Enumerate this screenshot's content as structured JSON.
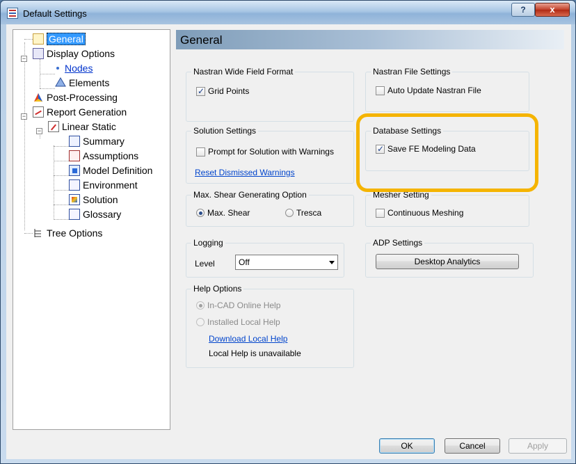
{
  "window": {
    "title": "Default Settings",
    "help_label": "?",
    "close_label": "x"
  },
  "tree": {
    "items": [
      {
        "label": "General",
        "icon": "general-settings-icon"
      },
      {
        "label": "Display Options",
        "icon": "display-options-icon"
      },
      {
        "label": "Nodes",
        "icon": "bullet-icon"
      },
      {
        "label": "Elements",
        "icon": "elements-icon"
      },
      {
        "label": "Post-Processing",
        "icon": "post-processing-icon"
      },
      {
        "label": "Report Generation",
        "icon": "report-generation-icon"
      },
      {
        "label": "Linear Static",
        "icon": "linear-static-icon"
      },
      {
        "label": "Summary",
        "icon": "summary-icon"
      },
      {
        "label": "Assumptions",
        "icon": "assumptions-icon"
      },
      {
        "label": "Model Definition",
        "icon": "model-definition-icon"
      },
      {
        "label": "Environment",
        "icon": "environment-icon"
      },
      {
        "label": "Solution",
        "icon": "solution-icon"
      },
      {
        "label": "Glossary",
        "icon": "glossary-icon"
      },
      {
        "label": "Tree Options",
        "icon": "tree-options-icon"
      }
    ],
    "expander_minus": "−"
  },
  "panel": {
    "title": "General",
    "nastran_wide": {
      "title": "Nastran Wide Field Format",
      "grid_points": "Grid Points"
    },
    "nastran_file": {
      "title": "Nastran File Settings",
      "auto_update": "Auto Update Nastran File"
    },
    "solution": {
      "title": "Solution Settings",
      "prompt": "Prompt for Solution with Warnings",
      "reset_link": "Reset Dismissed Warnings"
    },
    "database": {
      "title": "Database Settings",
      "save_fe": "Save FE Modeling Data"
    },
    "max_shear": {
      "title": "Max. Shear Generating Option",
      "max_shear": "Max. Shear",
      "tresca": "Tresca"
    },
    "mesher": {
      "title": "Mesher Setting",
      "continuous": "Continuous Meshing"
    },
    "logging": {
      "title": "Logging",
      "level_label": "Level",
      "level_value": "Off"
    },
    "adp": {
      "title": "ADP Settings",
      "button": "Desktop Analytics"
    },
    "help": {
      "title": "Help Options",
      "in_cad": "In-CAD Online Help",
      "installed": "Installed Local Help",
      "download_link": "Download Local Help",
      "status": "Local Help is unavailable"
    }
  },
  "footer": {
    "ok": "OK",
    "cancel": "Cancel",
    "apply": "Apply"
  },
  "colors": {
    "highlight": "#f5b400",
    "selection": "#3399ff",
    "link": "#0044cc"
  }
}
